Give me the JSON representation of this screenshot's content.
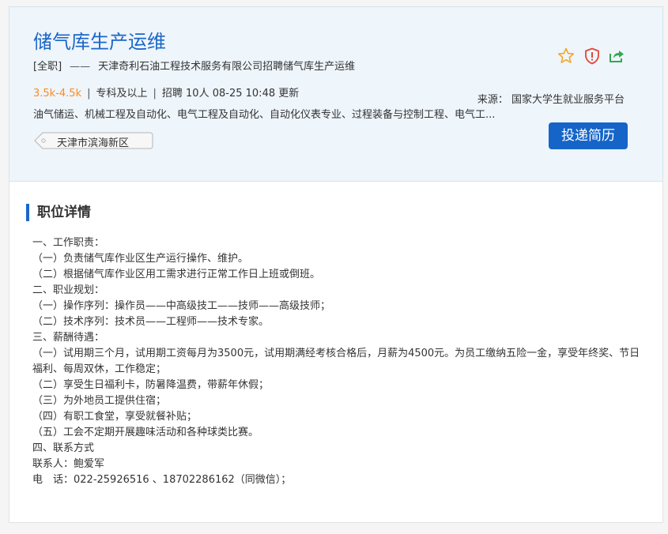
{
  "job": {
    "title": "储气库生产运维",
    "type": "[全职]",
    "dash": "——",
    "company_text": "天津奇利石油工程技术服务有限公司招聘储气库生产运维",
    "salary": "3.5k-4.5k",
    "education": "专科及以上",
    "recruit": "招聘 10人",
    "updated": "08-25 10:48 更新",
    "source": "来源： 国家大学生就业服务平台",
    "majors": "油气储运、机械工程及自动化、电气工程及自动化、自动化仪表专业、过程装备与控制工程、电气工...",
    "location": "天津市滨海新区",
    "apply_label": "投递简历"
  },
  "icons": {
    "favorite": "star-icon",
    "report": "shield-alert-icon",
    "share": "share-icon"
  },
  "colors": {
    "title_blue": "#1b66c9",
    "salary_orange": "#ff8a1f",
    "button_blue": "#1565c8",
    "star": "#f5a623",
    "shield": "#e0463a",
    "share": "#2fa84f"
  },
  "detail": {
    "heading": "职位详情",
    "lines": [
      "一、工作职责：",
      "（一）负责储气库作业区生产运行操作、维护。",
      "（二）根据储气库作业区用工需求进行正常工作日上班或倒班。",
      "二、职业规划：",
      "（一）操作序列：操作员——中高级技工——技师——高级技师；",
      "（二）技术序列：技术员——工程师——技术专家。",
      "三、薪酬待遇：",
      "（一）试用期三个月，试用期工资每月为3500元，试用期满经考核合格后，月薪为4500元。为员工缴纳五险一金，享受年终奖、节日福利、每周双休，工作稳定；",
      "（二）享受生日福利卡，防暑降温费，带薪年休假；",
      "（三）为外地员工提供住宿；",
      "（四）有职工食堂，享受就餐补贴；",
      "（五）工会不定期开展趣味活动和各种球类比赛。",
      "四、联系方式",
      "联系人：鲍爱军",
      "电　话：022-25926516 、18702286162（同微信）；"
    ]
  }
}
